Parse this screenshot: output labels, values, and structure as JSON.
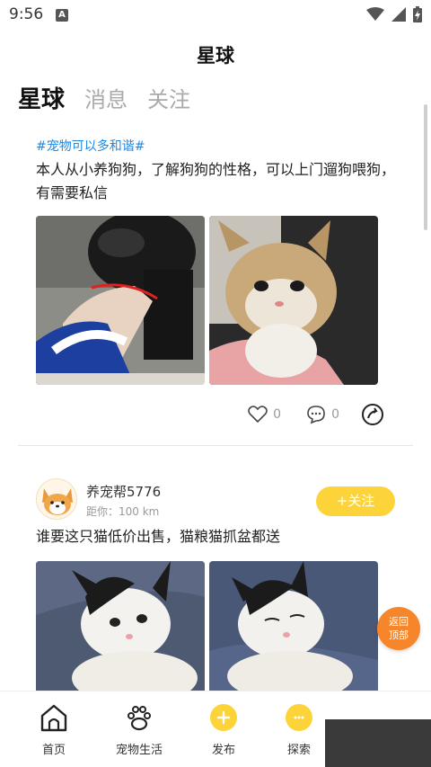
{
  "status_bar": {
    "time": "9:56",
    "notification_icon": "A"
  },
  "header": {
    "title": "星球"
  },
  "tabs": [
    {
      "label": "星球",
      "active": true
    },
    {
      "label": "消息",
      "active": false
    },
    {
      "label": "关注",
      "active": false
    }
  ],
  "posts": [
    {
      "hashtag": "#宠物可以多和谐#",
      "text": "本人从小养狗狗，了解狗狗的性格，可以上门遛狗喂狗，有需要私信",
      "likes": "0",
      "comments": "0"
    },
    {
      "username": "养宠帮5776",
      "distance": "距你：100 km",
      "follow_label": "+关注",
      "text": "谁要这只猫低价出售，猫粮猫抓盆都送"
    }
  ],
  "back_to_top": {
    "line1": "返回",
    "line2": "顶部"
  },
  "bottom_nav": [
    {
      "label": "首页",
      "icon": "home-icon"
    },
    {
      "label": "宠物生活",
      "icon": "paw-icon"
    },
    {
      "label": "发布",
      "icon": "plus-icon"
    },
    {
      "label": "探索",
      "icon": "chat-bubble-icon"
    }
  ],
  "colors": {
    "accent_yellow": "#fdd33a",
    "hashtag_blue": "#1e88e5",
    "back_top_orange": "#f7862b"
  }
}
